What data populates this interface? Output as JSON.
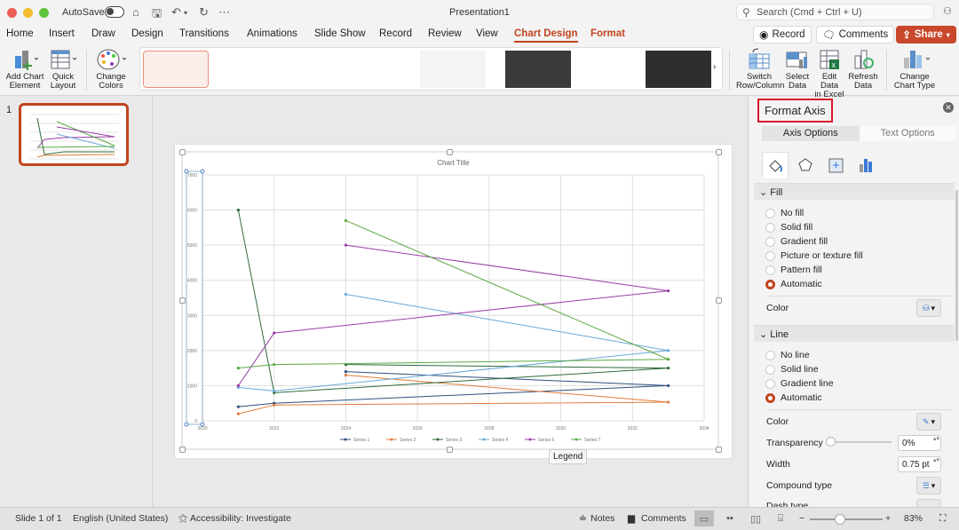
{
  "titlebar": {
    "autosave_label": "AutoSave",
    "doc_title": "Presentation1",
    "search_placeholder": "Search (Cmd + Ctrl + U)"
  },
  "tabs": [
    {
      "label": "Home"
    },
    {
      "label": "Insert"
    },
    {
      "label": "Draw"
    },
    {
      "label": "Design"
    },
    {
      "label": "Transitions"
    },
    {
      "label": "Animations"
    },
    {
      "label": "Slide Show"
    },
    {
      "label": "Record"
    },
    {
      "label": "Review"
    },
    {
      "label": "View"
    },
    {
      "label": "Chart Design",
      "active": true
    },
    {
      "label": "Format"
    }
  ],
  "header_buttons": {
    "record": "Record",
    "comments": "Comments",
    "share": "Share"
  },
  "ribbon": {
    "add_chart_element": [
      "Add Chart",
      "Element"
    ],
    "quick_layout": [
      "Quick",
      "Layout"
    ],
    "change_colors": [
      "Change",
      "Colors"
    ],
    "switch_row_column": [
      "Switch",
      "Row/Column"
    ],
    "select_data": [
      "Select",
      "Data"
    ],
    "edit_data_excel": [
      "Edit Data",
      "in Excel"
    ],
    "refresh_data": [
      "Refresh",
      "Data"
    ],
    "change_chart_type": [
      "Change",
      "Chart Type"
    ],
    "chart_styles_count": 8,
    "selected_style_index": 0
  },
  "slides_panel": {
    "slide_number": "1"
  },
  "tooltip": "Legend",
  "format_pane": {
    "title": "Format Axis",
    "tabs": [
      "Axis Options",
      "Text Options"
    ],
    "fill_section": "Fill",
    "fill_options": [
      "No fill",
      "Solid fill",
      "Gradient fill",
      "Picture or texture fill",
      "Pattern fill",
      "Automatic"
    ],
    "fill_selected": "Automatic",
    "fill_color_label": "Color",
    "line_section": "Line",
    "line_options": [
      "No line",
      "Solid line",
      "Gradient line",
      "Automatic"
    ],
    "line_selected": "Automatic",
    "line_color_label": "Color",
    "transparency_label": "Transparency",
    "transparency_value": "0%",
    "width_label": "Width",
    "width_value": "0.75 pt",
    "compound_label": "Compound type",
    "dash_label": "Dash type"
  },
  "status": {
    "slide": "Slide 1 of 1",
    "language": "English (United States)",
    "accessibility": "Accessibility: Investigate",
    "notes": "Notes",
    "comments": "Comments",
    "zoom": "83%"
  },
  "chart_data": {
    "type": "scatter",
    "title": "Chart Title",
    "xlabel": "",
    "ylabel": "",
    "xlim": [
      2020,
      2034
    ],
    "ylim": [
      0,
      7000
    ],
    "xticks": [
      2020,
      2022,
      2024,
      2026,
      2028,
      2030,
      2032,
      2034
    ],
    "yticks": [
      0,
      1000,
      2000,
      3000,
      4000,
      5000,
      6000,
      7000
    ],
    "grid": true,
    "legend": "bottom",
    "x": [
      2021,
      2022,
      2033,
      2024
    ],
    "series": [
      {
        "name": "Series 1",
        "color": "#2f4f7f",
        "values": [
          400,
          500,
          1000,
          1400
        ]
      },
      {
        "name": "Series 2",
        "color": "#e07b39",
        "values": [
          200,
          450,
          530,
          1300
        ]
      },
      {
        "name": "Series 3",
        "color": "#2e6b3a",
        "values": [
          6000,
          800,
          1500,
          1600
        ]
      },
      {
        "name": "Series 4",
        "color": "#6aa9d8",
        "values": [
          950,
          850,
          2000,
          3600
        ]
      },
      {
        "name": "Series 6",
        "color": "#9a3ea8",
        "values": [
          1000,
          2500,
          3700,
          5000
        ]
      },
      {
        "name": "Series 7",
        "color": "#5aa844",
        "values": [
          1500,
          1600,
          1750,
          5700
        ]
      }
    ]
  }
}
